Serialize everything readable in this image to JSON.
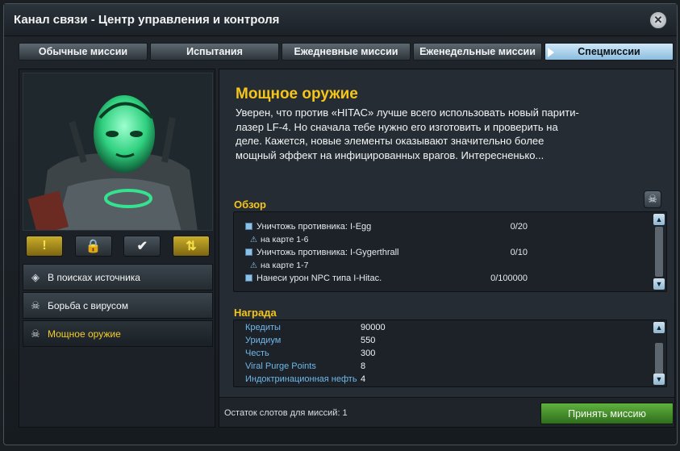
{
  "window": {
    "title": "Канал связи - Центр управления и контроля"
  },
  "tabs": [
    {
      "label": "Обычные миссии",
      "active": false
    },
    {
      "label": "Испытания",
      "active": false
    },
    {
      "label": "Ежедневные миссии",
      "active": false
    },
    {
      "label": "Еженедельные миссии",
      "active": false
    },
    {
      "label": "Спецмиссии",
      "active": true
    }
  ],
  "left": {
    "action_icons": [
      {
        "icon": "exclamation-icon",
        "glyph": "!"
      },
      {
        "icon": "lock-icon",
        "glyph": "🔒"
      },
      {
        "icon": "checkmark-icon",
        "glyph": "✔"
      },
      {
        "icon": "sort-arrows-icon",
        "glyph": "⇅"
      }
    ],
    "missions": [
      {
        "icon": "diamond-arrow-icon",
        "label": "В поисках источника",
        "active": false
      },
      {
        "icon": "skull-icon",
        "label": "Борьба с вирусом",
        "active": false
      },
      {
        "icon": "skull-icon",
        "label": "Мощное оружие",
        "active": true
      }
    ]
  },
  "mission": {
    "title": "Мощное оружие",
    "description_lines": [
      "Уверен, что против «HITAC» лучше всего использовать новый парити-",
      "лазер LF-4. Но сначала тебе нужно его изготовить и проверить на",
      "деле. Кажется, новые элементы оказывают значительно более",
      "мощный эффект на инфицированных врагов. Интересненько..."
    ]
  },
  "overview": {
    "title": "Обзор",
    "objectives": [
      {
        "text": "Уничтожь противника: I-Egg",
        "progress": "0/20",
        "sub": "на карте 1-6"
      },
      {
        "text": "Уничтожь противника: I-Gygerthrall",
        "progress": "0/10",
        "sub": "на карте 1-7"
      },
      {
        "text": "Нанеси урон NPC типа I-Hitac.",
        "progress": "0/100000",
        "sub": ""
      }
    ]
  },
  "reward": {
    "title": "Награда",
    "items": [
      {
        "label": "Кредиты",
        "value": "90000"
      },
      {
        "label": "Уридиум",
        "value": "550"
      },
      {
        "label": "Честь",
        "value": "300"
      },
      {
        "label": "Viral Purge Points",
        "value": "8"
      },
      {
        "label": "Индоктринационная нефть",
        "value": "4"
      }
    ]
  },
  "footer": {
    "slots_text": "Остаток слотов для миссий: 1",
    "accept_label": "Принять миссию"
  },
  "colors": {
    "accent_yellow": "#f5c51c",
    "active_tab": "#8cbddf",
    "accept_green": "#4c9a31",
    "reward_label_blue": "#6fb8ec"
  }
}
